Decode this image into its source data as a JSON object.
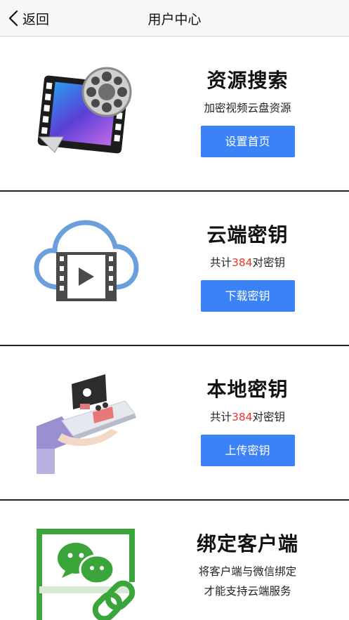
{
  "nav": {
    "back_label": "返回",
    "title": "用户中心"
  },
  "sections": [
    {
      "title": "资源搜索",
      "subtitle": "加密视频云盘资源",
      "button": "设置首页"
    },
    {
      "title": "云端密钥",
      "subtitle_prefix": "共计",
      "count": "384",
      "subtitle_suffix": "对密钥",
      "button": "下载密钥"
    },
    {
      "title": "本地密钥",
      "subtitle_prefix": "共计",
      "count": "384",
      "subtitle_suffix": "对密钥",
      "button": "上传密钥"
    },
    {
      "title": "绑定客户端",
      "line1": "将客户端与微信绑定",
      "line2": "才能支持云端服务"
    }
  ],
  "colors": {
    "button_bg": "#3b82f6",
    "highlight": "#e8352c",
    "cloud": "#6b9fdc",
    "wechat_green": "#3aa53a"
  }
}
